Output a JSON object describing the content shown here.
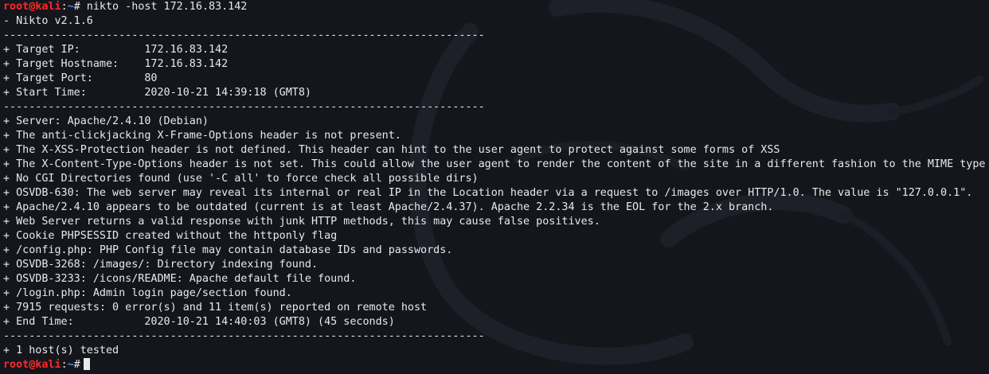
{
  "prompt": {
    "user": "root",
    "at": "@",
    "host": "kali",
    "sep": ":",
    "path": "~",
    "symbol": "#"
  },
  "command": " nikto -host 172.16.83.142",
  "output": [
    "- Nikto v2.1.6",
    "---------------------------------------------------------------------------",
    "+ Target IP:          172.16.83.142",
    "+ Target Hostname:    172.16.83.142",
    "+ Target Port:        80",
    "+ Start Time:         2020-10-21 14:39:18 (GMT8)",
    "---------------------------------------------------------------------------",
    "+ Server: Apache/2.4.10 (Debian)",
    "+ The anti-clickjacking X-Frame-Options header is not present.",
    "+ The X-XSS-Protection header is not defined. This header can hint to the user agent to protect against some forms of XSS",
    "+ The X-Content-Type-Options header is not set. This could allow the user agent to render the content of the site in a different fashion to the MIME type",
    "+ No CGI Directories found (use '-C all' to force check all possible dirs)",
    "+ OSVDB-630: The web server may reveal its internal or real IP in the Location header via a request to /images over HTTP/1.0. The value is \"127.0.0.1\".",
    "+ Apache/2.4.10 appears to be outdated (current is at least Apache/2.4.37). Apache 2.2.34 is the EOL for the 2.x branch.",
    "+ Web Server returns a valid response with junk HTTP methods, this may cause false positives.",
    "+ Cookie PHPSESSID created without the httponly flag",
    "+ /config.php: PHP Config file may contain database IDs and passwords.",
    "+ OSVDB-3268: /images/: Directory indexing found.",
    "+ OSVDB-3233: /icons/README: Apache default file found.",
    "+ /login.php: Admin login page/section found.",
    "+ 7915 requests: 0 error(s) and 11 item(s) reported on remote host",
    "+ End Time:           2020-10-21 14:40:03 (GMT8) (45 seconds)",
    "---------------------------------------------------------------------------",
    "+ 1 host(s) tested"
  ],
  "colors": {
    "background": "#14161c",
    "text": "#e9e9ea",
    "prompt_user": "#ff2a2a",
    "prompt_path": "#4c8cff"
  },
  "background_art": "kali-dragon-watermark"
}
